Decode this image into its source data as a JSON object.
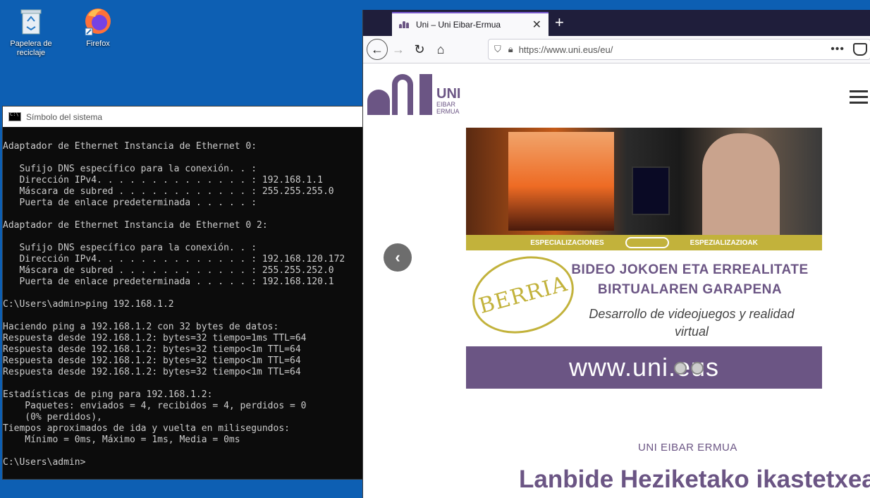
{
  "desktop": {
    "icons": [
      {
        "label": "Papelera de reciclaje"
      },
      {
        "label": "Firefox"
      }
    ]
  },
  "cmd": {
    "title": "Símbolo del sistema",
    "output": "\nAdaptador de Ethernet Instancia de Ethernet 0:\n\n   Sufijo DNS específico para la conexión. . :\n   Dirección IPv4. . . . . . . . . . . . . . : 192.168.1.1\n   Máscara de subred . . . . . . . . . . . . : 255.255.255.0\n   Puerta de enlace predeterminada . . . . . :\n\nAdaptador de Ethernet Instancia de Ethernet 0 2:\n\n   Sufijo DNS específico para la conexión. . :\n   Dirección IPv4. . . . . . . . . . . . . . : 192.168.120.172\n   Máscara de subred . . . . . . . . . . . . : 255.255.252.0\n   Puerta de enlace predeterminada . . . . . : 192.168.120.1\n\nC:\\Users\\admin>ping 192.168.1.2\n\nHaciendo ping a 192.168.1.2 con 32 bytes de datos:\nRespuesta desde 192.168.1.2: bytes=32 tiempo=1ms TTL=64\nRespuesta desde 192.168.1.2: bytes=32 tiempo<1m TTL=64\nRespuesta desde 192.168.1.2: bytes=32 tiempo<1m TTL=64\nRespuesta desde 192.168.1.2: bytes=32 tiempo<1m TTL=64\n\nEstadísticas de ping para 192.168.1.2:\n    Paquetes: enviados = 4, recibidos = 4, perdidos = 0\n    (0% perdidos),\nTiempos aproximados de ida y vuelta en milisegundos:\n    Mínimo = 0ms, Máximo = 1ms, Media = 0ms\n\nC:\\Users\\admin>"
  },
  "browser": {
    "tab_title": "Uni – Uni Eibar-Ermua",
    "url": "https://www.uni.eus/eu/",
    "accent": "#6b5584"
  },
  "page": {
    "logo": {
      "name": "UNI",
      "sub1": "EIBAR",
      "sub2": "ERMUA"
    },
    "banner": {
      "strip_left": "ESPECIALIZACIONES",
      "strip_right": "ESPEZIALIZAZIOAK",
      "seal": "BERRIA",
      "headline_1": "BIDEO JOKOEN ETA ERREALITATE",
      "headline_2": "BIRTUALAREN  GARAPENA",
      "subtitle": "Desarrollo de videojuegos y realidad virtual",
      "website": "www.uni.eus"
    },
    "kicker": "UNI EIBAR ERMUA",
    "heading": "Lanbide Heziketako ikastetxea"
  }
}
